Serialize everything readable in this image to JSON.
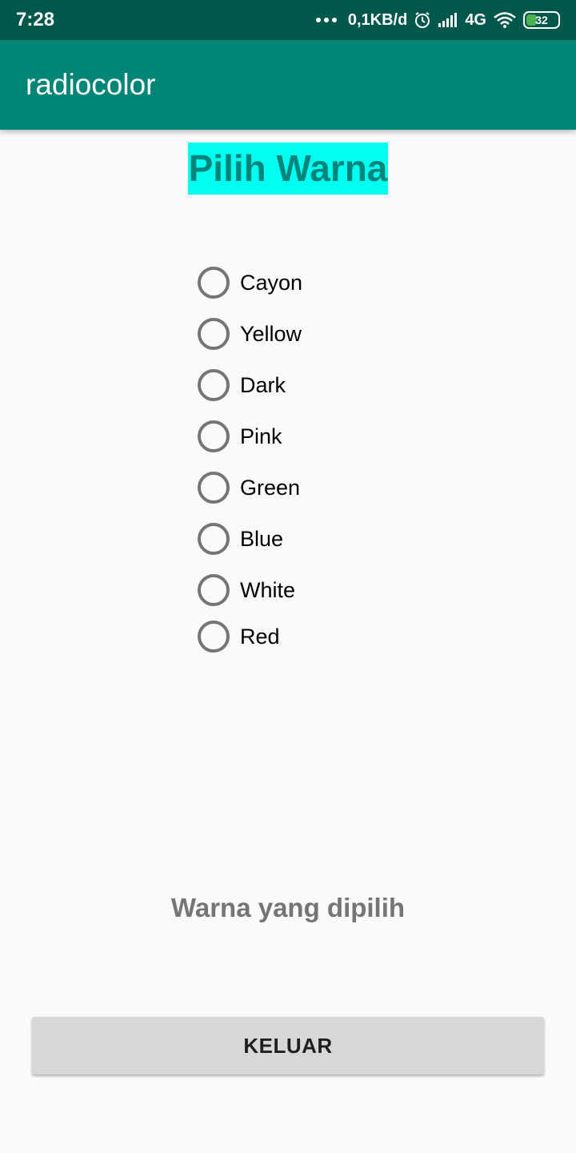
{
  "status_bar": {
    "time": "7:28",
    "speed": "0,1KB/d",
    "network": "4G",
    "battery": "32",
    "battery_level": 0.32,
    "icons": [
      "more-dots-icon",
      "alarm-icon",
      "signal-icon",
      "wifi-icon",
      "battery-icon"
    ]
  },
  "app_bar": {
    "title": "radiocolor"
  },
  "heading": {
    "text": "Pilih Warna",
    "bg_color": "#00fff0",
    "text_color": "#00857c"
  },
  "radio_group": {
    "options": [
      {
        "label": "Cayon",
        "checked": false
      },
      {
        "label": "Yellow",
        "checked": false
      },
      {
        "label": "Dark",
        "checked": false
      },
      {
        "label": "Pink",
        "checked": false
      },
      {
        "label": "Green",
        "checked": false
      },
      {
        "label": "Blue",
        "checked": false
      },
      {
        "label": "White",
        "checked": false
      },
      {
        "label": "Red",
        "checked": false
      }
    ]
  },
  "result": {
    "text": "Warna yang dipilih"
  },
  "button": {
    "label": "KELUAR"
  },
  "colors": {
    "primary": "#008577",
    "primary_dark": "#00574b",
    "accent": "#00fff0"
  }
}
